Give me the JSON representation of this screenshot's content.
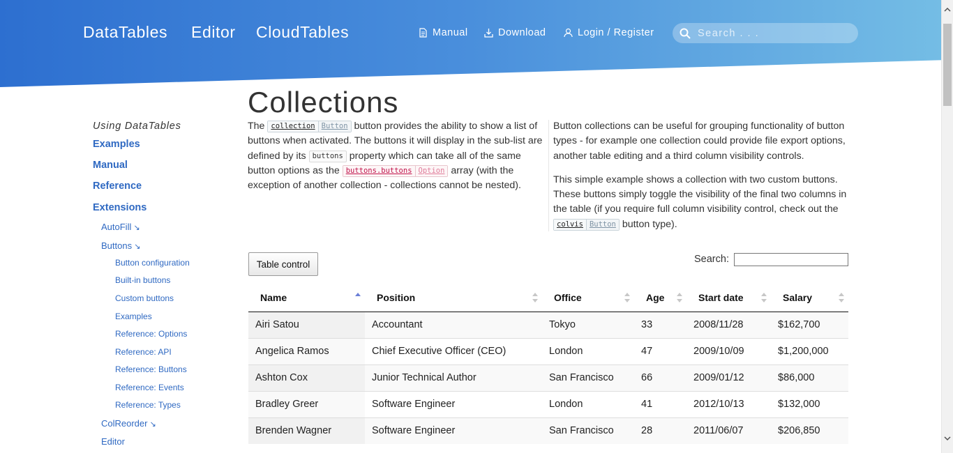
{
  "header": {
    "brand": [
      "DataTables",
      "Editor",
      "CloudTables"
    ],
    "nav": {
      "manual": "Manual",
      "download": "Download",
      "login": "Login / Register"
    },
    "search_placeholder": "Search . . ."
  },
  "sidebar": {
    "heading": "Using DataTables",
    "top_items": [
      "Examples",
      "Manual",
      "Reference",
      "Extensions"
    ],
    "extensions": {
      "autofill": "AutoFill",
      "buttons": "Buttons",
      "buttons_children": [
        "Button configuration",
        "Built-in buttons",
        "Custom buttons",
        "Examples",
        "Reference: Options",
        "Reference: API",
        "Reference: Buttons",
        "Reference: Events",
        "Reference: Types"
      ],
      "colreorder": "ColReorder",
      "editor": "Editor"
    },
    "arrow": "↘"
  },
  "main": {
    "title": "Collections",
    "left": {
      "p1_pre": "The",
      "tag_collection": "collection",
      "tag_button": "Button",
      "p1_mid": "button provides the ability to show a list of buttons when activated. The buttons it will display in the sub-list are defined by its",
      "code_buttons": "buttons",
      "p1_mid2": "property which can take all of the same button options as the",
      "tag_buttons_buttons": "buttons.buttons",
      "tag_option": "Option",
      "p1_post": "array (with the exception of another collection - collections cannot be nested)."
    },
    "right": {
      "p1": "Button collections can be useful for grouping functionality of button types - for example one collection could provide file export options, another table editing and a third column visibility controls.",
      "p2_pre": "This simple example shows a collection with two custom buttons. These buttons simply toggle the visibility of the final two columns in the table (if you require full column visibility control, check out the",
      "tag_colvis": "colvis",
      "tag_button": "Button",
      "p2_post": "button type)."
    },
    "button_label": "Table control",
    "search_label": "Search:"
  },
  "table": {
    "headers": [
      "Name",
      "Position",
      "Office",
      "Age",
      "Start date",
      "Salary"
    ],
    "sorted_column": "Name",
    "rows": [
      [
        "Airi Satou",
        "Accountant",
        "Tokyo",
        "33",
        "2008/11/28",
        "$162,700"
      ],
      [
        "Angelica Ramos",
        "Chief Executive Officer (CEO)",
        "London",
        "47",
        "2009/10/09",
        "$1,200,000"
      ],
      [
        "Ashton Cox",
        "Junior Technical Author",
        "San Francisco",
        "66",
        "2009/01/12",
        "$86,000"
      ],
      [
        "Bradley Greer",
        "Software Engineer",
        "London",
        "41",
        "2012/10/13",
        "$132,000"
      ],
      [
        "Brenden Wagner",
        "Software Engineer",
        "San Francisco",
        "28",
        "2011/06/07",
        "$206,850"
      ]
    ]
  }
}
